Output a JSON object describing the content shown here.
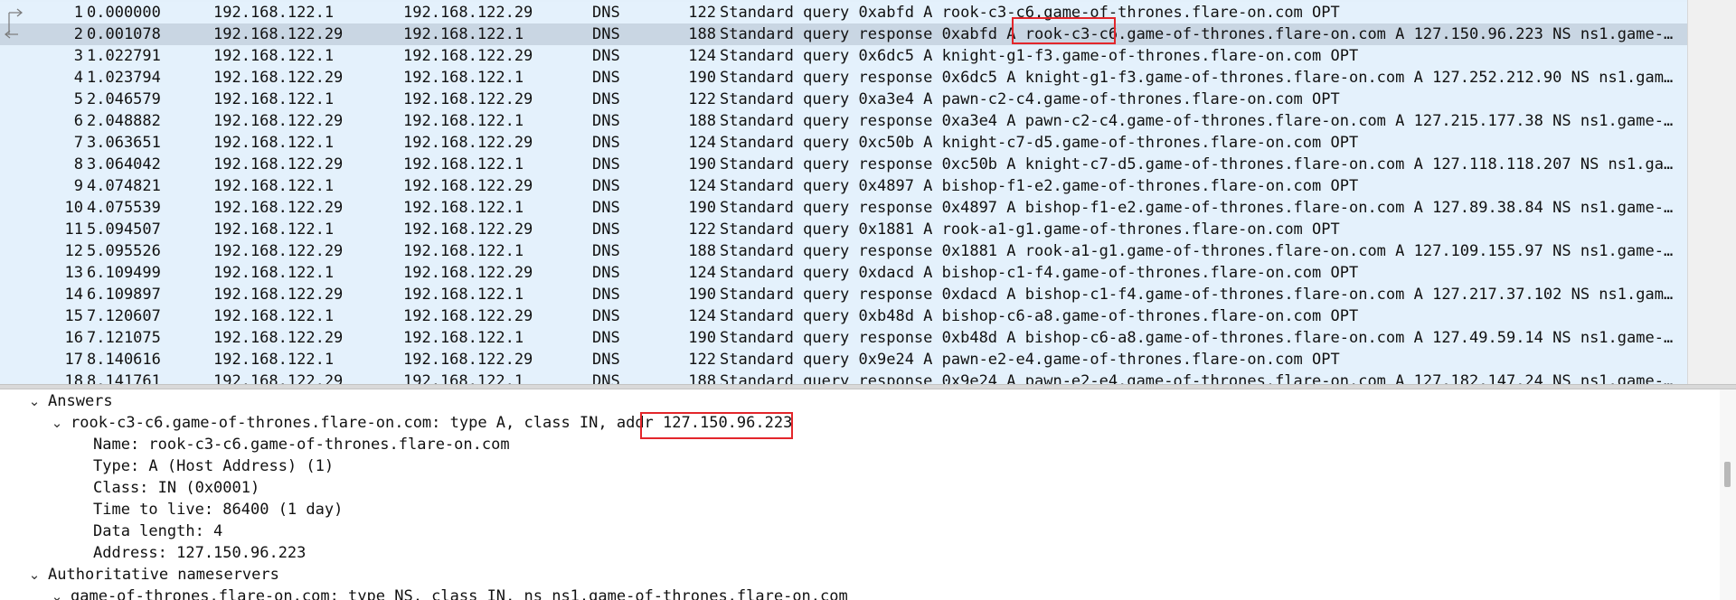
{
  "packet_list": {
    "rows": [
      {
        "no": "1",
        "time": "0.000000",
        "src": "192.168.122.1",
        "dst": "192.168.122.29",
        "proto": "DNS",
        "len": "122",
        "info": "Standard query 0xabfd A rook-c3-c6.game-of-thrones.flare-on.com OPT"
      },
      {
        "no": "2",
        "time": "0.001078",
        "src": "192.168.122.29",
        "dst": "192.168.122.1",
        "proto": "DNS",
        "len": "188",
        "info": "Standard query response 0xabfd A rook-c3-c6.game-of-thrones.flare-on.com A 127.150.96.223 NS ns1.game-of-…"
      },
      {
        "no": "3",
        "time": "1.022791",
        "src": "192.168.122.1",
        "dst": "192.168.122.29",
        "proto": "DNS",
        "len": "124",
        "info": "Standard query 0x6dc5 A knight-g1-f3.game-of-thrones.flare-on.com OPT"
      },
      {
        "no": "4",
        "time": "1.023794",
        "src": "192.168.122.29",
        "dst": "192.168.122.1",
        "proto": "DNS",
        "len": "190",
        "info": "Standard query response 0x6dc5 A knight-g1-f3.game-of-thrones.flare-on.com A 127.252.212.90 NS ns1.game-o…"
      },
      {
        "no": "5",
        "time": "2.046579",
        "src": "192.168.122.1",
        "dst": "192.168.122.29",
        "proto": "DNS",
        "len": "122",
        "info": "Standard query 0xa3e4 A pawn-c2-c4.game-of-thrones.flare-on.com OPT"
      },
      {
        "no": "6",
        "time": "2.048882",
        "src": "192.168.122.29",
        "dst": "192.168.122.1",
        "proto": "DNS",
        "len": "188",
        "info": "Standard query response 0xa3e4 A pawn-c2-c4.game-of-thrones.flare-on.com A 127.215.177.38 NS ns1.game-of-…"
      },
      {
        "no": "7",
        "time": "3.063651",
        "src": "192.168.122.1",
        "dst": "192.168.122.29",
        "proto": "DNS",
        "len": "124",
        "info": "Standard query 0xc50b A knight-c7-d5.game-of-thrones.flare-on.com OPT"
      },
      {
        "no": "8",
        "time": "3.064042",
        "src": "192.168.122.29",
        "dst": "192.168.122.1",
        "proto": "DNS",
        "len": "190",
        "info": "Standard query response 0xc50b A knight-c7-d5.game-of-thrones.flare-on.com A 127.118.118.207 NS ns1.game-…"
      },
      {
        "no": "9",
        "time": "4.074821",
        "src": "192.168.122.1",
        "dst": "192.168.122.29",
        "proto": "DNS",
        "len": "124",
        "info": "Standard query 0x4897 A bishop-f1-e2.game-of-thrones.flare-on.com OPT"
      },
      {
        "no": "10",
        "time": "4.075539",
        "src": "192.168.122.29",
        "dst": "192.168.122.1",
        "proto": "DNS",
        "len": "190",
        "info": "Standard query response 0x4897 A bishop-f1-e2.game-of-thrones.flare-on.com A 127.89.38.84 NS ns1.game-of-…"
      },
      {
        "no": "11",
        "time": "5.094507",
        "src": "192.168.122.1",
        "dst": "192.168.122.29",
        "proto": "DNS",
        "len": "122",
        "info": "Standard query 0x1881 A rook-a1-g1.game-of-thrones.flare-on.com OPT"
      },
      {
        "no": "12",
        "time": "5.095526",
        "src": "192.168.122.29",
        "dst": "192.168.122.1",
        "proto": "DNS",
        "len": "188",
        "info": "Standard query response 0x1881 A rook-a1-g1.game-of-thrones.flare-on.com A 127.109.155.97 NS ns1.game-of-…"
      },
      {
        "no": "13",
        "time": "6.109499",
        "src": "192.168.122.1",
        "dst": "192.168.122.29",
        "proto": "DNS",
        "len": "124",
        "info": "Standard query 0xdacd A bishop-c1-f4.game-of-thrones.flare-on.com OPT"
      },
      {
        "no": "14",
        "time": "6.109897",
        "src": "192.168.122.29",
        "dst": "192.168.122.1",
        "proto": "DNS",
        "len": "190",
        "info": "Standard query response 0xdacd A bishop-c1-f4.game-of-thrones.flare-on.com A 127.217.37.102 NS ns1.game-o…"
      },
      {
        "no": "15",
        "time": "7.120607",
        "src": "192.168.122.1",
        "dst": "192.168.122.29",
        "proto": "DNS",
        "len": "124",
        "info": "Standard query 0xb48d A bishop-c6-a8.game-of-thrones.flare-on.com OPT"
      },
      {
        "no": "16",
        "time": "7.121075",
        "src": "192.168.122.29",
        "dst": "192.168.122.1",
        "proto": "DNS",
        "len": "190",
        "info": "Standard query response 0xb48d A bishop-c6-a8.game-of-thrones.flare-on.com A 127.49.59.14 NS ns1.game-of-…"
      },
      {
        "no": "17",
        "time": "8.140616",
        "src": "192.168.122.1",
        "dst": "192.168.122.29",
        "proto": "DNS",
        "len": "122",
        "info": "Standard query 0x9e24 A pawn-e2-e4.game-of-thrones.flare-on.com OPT"
      },
      {
        "no": "18",
        "time": "8.141761",
        "src": "192.168.122.29",
        "dst": "192.168.122.1",
        "proto": "DNS",
        "len": "188",
        "info": "Standard query response 0x9e24 A pawn-e2-e4.game-of-thrones.flare-on.com A 127.182.147.24 NS ns1.game-of-…"
      }
    ],
    "selected_row": "2"
  },
  "packet_details": {
    "rows": [
      {
        "text": "Answers",
        "expanded": true
      },
      {
        "text": "rook-c3-c6.game-of-thrones.flare-on.com: type A, class IN, addr 127.150.96.223",
        "expanded": true
      },
      {
        "text": "Name: rook-c3-c6.game-of-thrones.flare-on.com"
      },
      {
        "text": "Type: A (Host Address) (1)"
      },
      {
        "text": "Class: IN (0x0001)"
      },
      {
        "text": "Time to live: 86400 (1 day)"
      },
      {
        "text": "Data length: 4"
      },
      {
        "text": "Address: 127.150.96.223"
      },
      {
        "text": "Authoritative nameservers",
        "expanded": true
      },
      {
        "text": "game-of-thrones.flare-on.com: type NS, class IN, ns ns1.game-of-thrones.flare-on.com",
        "expanded": true
      }
    ]
  },
  "icons": {
    "expanded_chevron": "chevron-down-icon",
    "related_packet": "related-packet-icon"
  },
  "colors": {
    "list_background": "#e4f1fc",
    "selected_row": "#c9d6e3",
    "highlight_box": "#e3262b"
  }
}
